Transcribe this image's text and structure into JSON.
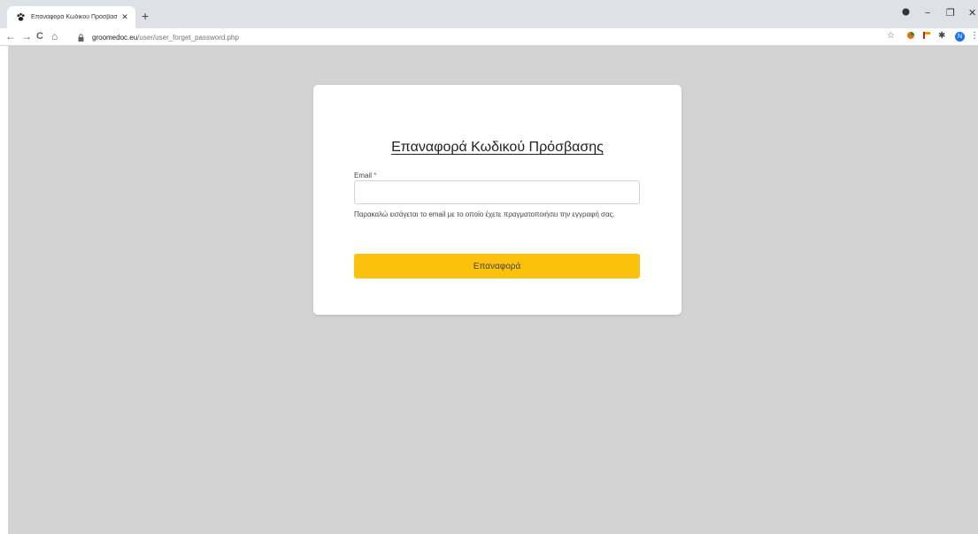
{
  "browser": {
    "tab_title": "Επαναφορά Κωδικού Πρόσβασ",
    "tab_close": "✕",
    "new_tab": "+",
    "url_host": "groomedoc.eu",
    "url_path": "/user/user_forget_password.php",
    "profile_initial": "N",
    "nav": {
      "back": "←",
      "forward": "→",
      "reload": "C",
      "home": "⌂"
    },
    "window": {
      "minimize": "−",
      "restore": "❐",
      "close": "✕"
    },
    "menu": "⋮"
  },
  "form": {
    "title": "Επαναφορά Κωδικού Πρόσβασης",
    "email_label": "Email",
    "required_mark": "*",
    "email_value": "",
    "help_text": "Παρακαλώ εισάγεται το email με το οποίο έχετε πραγματοποιήσει την εγγραφή σας.",
    "submit_label": "Επαναφορά"
  },
  "colors": {
    "page_bg": "#d3d3d3",
    "card_bg": "#ffffff",
    "button_bg": "#fcc10c",
    "required": "#e74c3c"
  },
  "icons": {
    "favicon": "paw-icon",
    "lock": "lock-icon",
    "bookmark": "star-icon",
    "extensions": "puzzle-icon"
  }
}
